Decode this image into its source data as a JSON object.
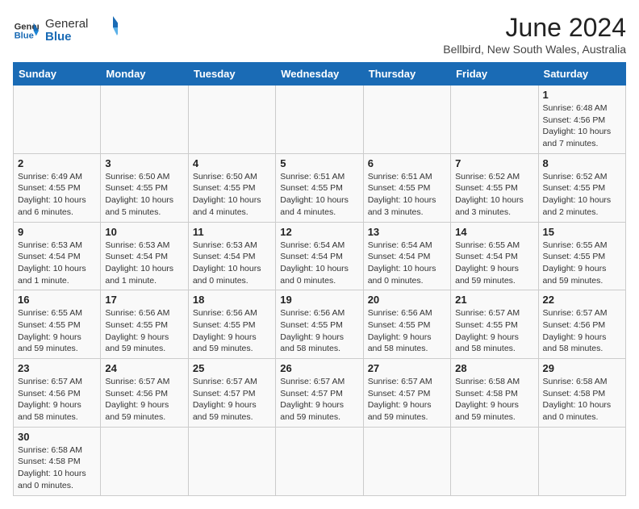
{
  "header": {
    "logo_general": "General",
    "logo_blue": "Blue",
    "month_title": "June 2024",
    "location": "Bellbird, New South Wales, Australia"
  },
  "weekdays": [
    "Sunday",
    "Monday",
    "Tuesday",
    "Wednesday",
    "Thursday",
    "Friday",
    "Saturday"
  ],
  "weeks": [
    [
      {
        "day": "",
        "info": ""
      },
      {
        "day": "",
        "info": ""
      },
      {
        "day": "",
        "info": ""
      },
      {
        "day": "",
        "info": ""
      },
      {
        "day": "",
        "info": ""
      },
      {
        "day": "",
        "info": ""
      },
      {
        "day": "1",
        "info": "Sunrise: 6:48 AM\nSunset: 4:56 PM\nDaylight: 10 hours\nand 7 minutes."
      }
    ],
    [
      {
        "day": "2",
        "info": "Sunrise: 6:49 AM\nSunset: 4:55 PM\nDaylight: 10 hours\nand 6 minutes."
      },
      {
        "day": "3",
        "info": "Sunrise: 6:50 AM\nSunset: 4:55 PM\nDaylight: 10 hours\nand 5 minutes."
      },
      {
        "day": "4",
        "info": "Sunrise: 6:50 AM\nSunset: 4:55 PM\nDaylight: 10 hours\nand 4 minutes."
      },
      {
        "day": "5",
        "info": "Sunrise: 6:51 AM\nSunset: 4:55 PM\nDaylight: 10 hours\nand 4 minutes."
      },
      {
        "day": "6",
        "info": "Sunrise: 6:51 AM\nSunset: 4:55 PM\nDaylight: 10 hours\nand 3 minutes."
      },
      {
        "day": "7",
        "info": "Sunrise: 6:52 AM\nSunset: 4:55 PM\nDaylight: 10 hours\nand 3 minutes."
      },
      {
        "day": "8",
        "info": "Sunrise: 6:52 AM\nSunset: 4:55 PM\nDaylight: 10 hours\nand 2 minutes."
      }
    ],
    [
      {
        "day": "9",
        "info": "Sunrise: 6:53 AM\nSunset: 4:54 PM\nDaylight: 10 hours\nand 1 minute."
      },
      {
        "day": "10",
        "info": "Sunrise: 6:53 AM\nSunset: 4:54 PM\nDaylight: 10 hours\nand 1 minute."
      },
      {
        "day": "11",
        "info": "Sunrise: 6:53 AM\nSunset: 4:54 PM\nDaylight: 10 hours\nand 0 minutes."
      },
      {
        "day": "12",
        "info": "Sunrise: 6:54 AM\nSunset: 4:54 PM\nDaylight: 10 hours\nand 0 minutes."
      },
      {
        "day": "13",
        "info": "Sunrise: 6:54 AM\nSunset: 4:54 PM\nDaylight: 10 hours\nand 0 minutes."
      },
      {
        "day": "14",
        "info": "Sunrise: 6:55 AM\nSunset: 4:54 PM\nDaylight: 9 hours\nand 59 minutes."
      },
      {
        "day": "15",
        "info": "Sunrise: 6:55 AM\nSunset: 4:55 PM\nDaylight: 9 hours\nand 59 minutes."
      }
    ],
    [
      {
        "day": "16",
        "info": "Sunrise: 6:55 AM\nSunset: 4:55 PM\nDaylight: 9 hours\nand 59 minutes."
      },
      {
        "day": "17",
        "info": "Sunrise: 6:56 AM\nSunset: 4:55 PM\nDaylight: 9 hours\nand 59 minutes."
      },
      {
        "day": "18",
        "info": "Sunrise: 6:56 AM\nSunset: 4:55 PM\nDaylight: 9 hours\nand 59 minutes."
      },
      {
        "day": "19",
        "info": "Sunrise: 6:56 AM\nSunset: 4:55 PM\nDaylight: 9 hours\nand 58 minutes."
      },
      {
        "day": "20",
        "info": "Sunrise: 6:56 AM\nSunset: 4:55 PM\nDaylight: 9 hours\nand 58 minutes."
      },
      {
        "day": "21",
        "info": "Sunrise: 6:57 AM\nSunset: 4:55 PM\nDaylight: 9 hours\nand 58 minutes."
      },
      {
        "day": "22",
        "info": "Sunrise: 6:57 AM\nSunset: 4:56 PM\nDaylight: 9 hours\nand 58 minutes."
      }
    ],
    [
      {
        "day": "23",
        "info": "Sunrise: 6:57 AM\nSunset: 4:56 PM\nDaylight: 9 hours\nand 58 minutes."
      },
      {
        "day": "24",
        "info": "Sunrise: 6:57 AM\nSunset: 4:56 PM\nDaylight: 9 hours\nand 59 minutes."
      },
      {
        "day": "25",
        "info": "Sunrise: 6:57 AM\nSunset: 4:57 PM\nDaylight: 9 hours\nand 59 minutes."
      },
      {
        "day": "26",
        "info": "Sunrise: 6:57 AM\nSunset: 4:57 PM\nDaylight: 9 hours\nand 59 minutes."
      },
      {
        "day": "27",
        "info": "Sunrise: 6:57 AM\nSunset: 4:57 PM\nDaylight: 9 hours\nand 59 minutes."
      },
      {
        "day": "28",
        "info": "Sunrise: 6:58 AM\nSunset: 4:58 PM\nDaylight: 9 hours\nand 59 minutes."
      },
      {
        "day": "29",
        "info": "Sunrise: 6:58 AM\nSunset: 4:58 PM\nDaylight: 10 hours\nand 0 minutes."
      }
    ],
    [
      {
        "day": "30",
        "info": "Sunrise: 6:58 AM\nSunset: 4:58 PM\nDaylight: 10 hours\nand 0 minutes."
      },
      {
        "day": "",
        "info": ""
      },
      {
        "day": "",
        "info": ""
      },
      {
        "day": "",
        "info": ""
      },
      {
        "day": "",
        "info": ""
      },
      {
        "day": "",
        "info": ""
      },
      {
        "day": "",
        "info": ""
      }
    ]
  ]
}
